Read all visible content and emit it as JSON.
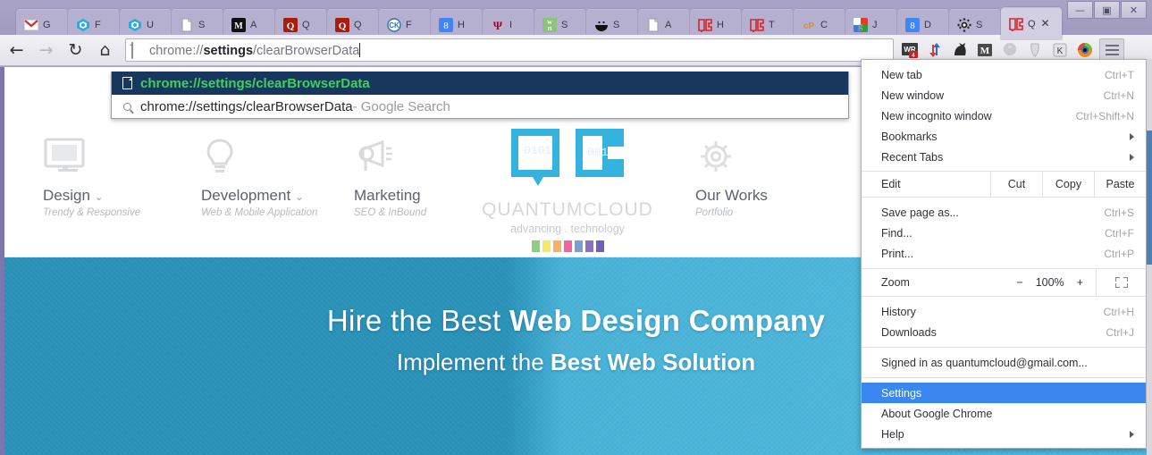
{
  "window": {
    "controls": [
      {
        "name": "minimize",
        "glyph": "—"
      },
      {
        "name": "restore",
        "glyph": "▣"
      },
      {
        "name": "close",
        "glyph": "✕"
      }
    ]
  },
  "tabstrip": {
    "tabs": [
      {
        "favicon": "gmail-icon",
        "title": "G",
        "active": false
      },
      {
        "favicon": "cube-icon",
        "title": "F",
        "active": false
      },
      {
        "favicon": "cube-icon",
        "title": "U",
        "active": false
      },
      {
        "favicon": "document-icon",
        "title": "S",
        "active": false
      },
      {
        "favicon": "m-black-icon",
        "title": "A",
        "active": false
      },
      {
        "favicon": "q-red-icon",
        "title": "Q",
        "active": false
      },
      {
        "favicon": "q-red-icon",
        "title": "Q",
        "active": false
      },
      {
        "favicon": "ck-icon",
        "title": "F",
        "active": false
      },
      {
        "favicon": "google-blue-icon",
        "title": "H",
        "active": false
      },
      {
        "favicon": "trident-icon",
        "title": "I",
        "active": false
      },
      {
        "favicon": "wh-green-icon",
        "title": "S",
        "active": false
      },
      {
        "favicon": "smiley-icon",
        "title": "S",
        "active": false
      },
      {
        "favicon": "document-icon",
        "title": "A",
        "active": false
      },
      {
        "favicon": "qc-red-icon",
        "title": "H",
        "active": false
      },
      {
        "favicon": "qc-red-icon",
        "title": "T",
        "active": false
      },
      {
        "favicon": "cp-orange-icon",
        "title": "C",
        "active": false
      },
      {
        "favicon": "google-multi-icon",
        "title": "J",
        "active": false
      },
      {
        "favicon": "google-blue-icon",
        "title": "D",
        "active": false
      },
      {
        "favicon": "gear-icon",
        "title": "S",
        "active": false
      },
      {
        "favicon": "qc-red-icon",
        "title": "Q",
        "active": true,
        "close": "✕"
      }
    ],
    "new_tab_button": "new-tab-button"
  },
  "toolbar": {
    "back_glyph": "←",
    "forward_glyph": "→",
    "reload_glyph": "↻",
    "home_glyph": "⌂",
    "url_prefix": "chrome://",
    "url_strong": "settings",
    "url_suffix": "/clearBrowserData",
    "url_full": "chrome://settings/clearBrowserData",
    "extensions": [
      {
        "name": "wr-extension-icon",
        "label": "WR",
        "badge": "4"
      },
      {
        "name": "updown-arrows-icon",
        "label": ""
      },
      {
        "name": "cat-icon",
        "label": ""
      },
      {
        "name": "gmail-m-icon",
        "label": "M"
      },
      {
        "name": "hangouts-quote-icon",
        "label": ""
      },
      {
        "name": "mask-icon",
        "label": ""
      },
      {
        "name": "k-key-icon",
        "label": "K"
      },
      {
        "name": "firefox-circle-icon",
        "label": ""
      }
    ]
  },
  "omnibox_dropdown": {
    "rows": [
      {
        "icon": "document-icon",
        "text": "chrome://settings/clearBrowserData",
        "suffix": "",
        "selected": true
      },
      {
        "icon": "search-icon",
        "text": "chrome://settings/clearBrowserData",
        "suffix": " - Google Search",
        "selected": false
      }
    ]
  },
  "chrome_menu": {
    "items": [
      {
        "label": "New tab",
        "accel": "Ctrl+T",
        "arrow": false,
        "selected": false
      },
      {
        "label": "New window",
        "accel": "Ctrl+N",
        "arrow": false,
        "selected": false
      },
      {
        "label": "New incognito window",
        "accel": "Ctrl+Shift+N",
        "arrow": false,
        "selected": false
      },
      {
        "label": "Bookmarks",
        "accel": "",
        "arrow": true,
        "selected": false
      },
      {
        "label": "Recent Tabs",
        "accel": "",
        "arrow": true,
        "selected": false
      }
    ],
    "edit_row": {
      "label": "Edit",
      "buttons": [
        "Cut",
        "Copy",
        "Paste"
      ]
    },
    "file_items": [
      {
        "label": "Save page as...",
        "accel": "Ctrl+S",
        "arrow": false,
        "selected": false
      },
      {
        "label": "Find...",
        "accel": "Ctrl+F",
        "arrow": false,
        "selected": false
      },
      {
        "label": "Print...",
        "accel": "Ctrl+P",
        "arrow": false,
        "selected": false
      }
    ],
    "zoom_row": {
      "label": "Zoom",
      "minus": "−",
      "level": "100%",
      "plus": "+",
      "fullscreen": "fullscreen-icon"
    },
    "history_items": [
      {
        "label": "History",
        "accel": "Ctrl+H",
        "arrow": false,
        "selected": false
      },
      {
        "label": "Downloads",
        "accel": "Ctrl+J",
        "arrow": false,
        "selected": false
      }
    ],
    "account_item": {
      "label": "Signed in as quantumcloud@gmail.com...",
      "accel": "",
      "arrow": false,
      "selected": false
    },
    "bottom_items": [
      {
        "label": "Settings",
        "accel": "",
        "arrow": false,
        "selected": true
      },
      {
        "label": "About Google Chrome",
        "accel": "",
        "arrow": false,
        "selected": false
      },
      {
        "label": "Help",
        "accel": "",
        "arrow": true,
        "selected": false
      }
    ]
  },
  "page": {
    "services": [
      {
        "icon": "monitor-icon",
        "title": "Design",
        "caret": "⌄",
        "sub": "Trendy & Responsive"
      },
      {
        "icon": "bulb-icon",
        "title": "Development",
        "caret": "⌄",
        "sub": "Web & Mobile Application"
      },
      {
        "icon": "megaphone-icon",
        "title": "Marketing",
        "caret": "",
        "sub": "SEO & InBound"
      },
      {
        "icon": "gear-icon",
        "title": "Our Works",
        "caret": "",
        "sub": "Portfolio"
      }
    ],
    "brand": {
      "logo": "quantumcloud-logo",
      "name": "QUANTUMCLOUD",
      "tagline": "advancing . technology",
      "color_bars": [
        "#8cd17d",
        "#f5e96b",
        "#f7b267",
        "#f4639c",
        "#7b9fd4",
        "#8e6fc4",
        "#6f5fb8"
      ]
    },
    "hero": {
      "line1_light": "Hire the Best ",
      "line1_bold": "Web Design Company",
      "line2_light": "Implement the ",
      "line2_bold": "Best Web Solution"
    }
  },
  "colors": {
    "accent_blue": "#2a92b9",
    "hero_light": "#52bade",
    "menu_highlight": "#3b87f0",
    "omni_selected_bg": "#17375e",
    "omni_selected_text": "#3fd15a",
    "frame": "#a9a3c6"
  }
}
